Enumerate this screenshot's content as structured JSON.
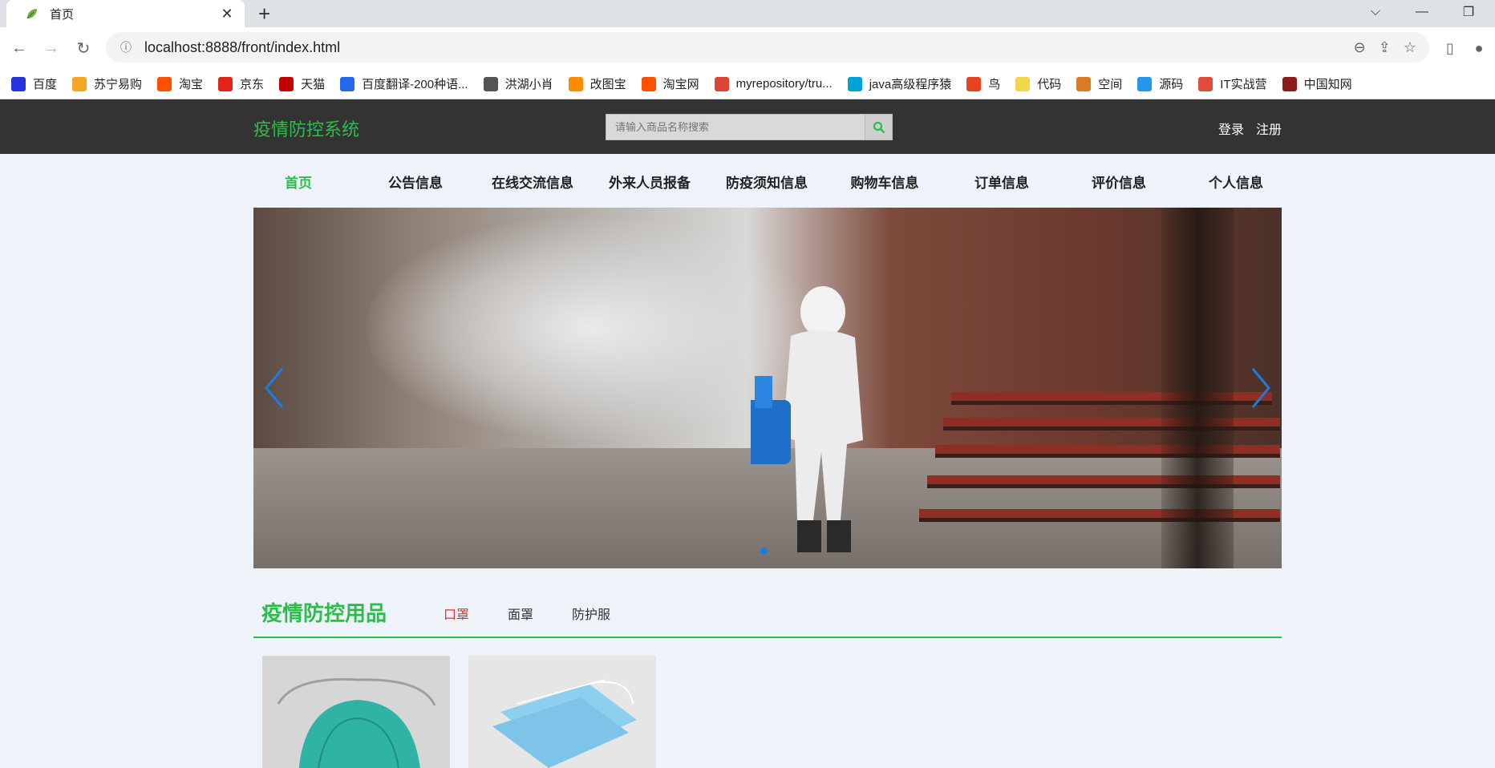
{
  "browser": {
    "tab": {
      "title": "首页"
    },
    "url": "localhost:8888/front/index.html",
    "bookmarks": [
      {
        "label": "百度",
        "icon": "baidu-icon",
        "color": "#2932e1"
      },
      {
        "label": "苏宁易购",
        "icon": "suning-icon",
        "color": "#f5a623"
      },
      {
        "label": "淘宝",
        "icon": "taobao-icon",
        "color": "#ff5000"
      },
      {
        "label": "京东",
        "icon": "jd-icon",
        "color": "#e1251b"
      },
      {
        "label": "天猫",
        "icon": "tmall-icon",
        "color": "#c40000"
      },
      {
        "label": "百度翻译-200种语...",
        "icon": "translate-icon",
        "color": "#2468f2"
      },
      {
        "label": "洪湖小肖",
        "icon": "bird-icon",
        "color": "#555555"
      },
      {
        "label": "改图宝",
        "icon": "image-tool-icon",
        "color": "#ff8c00"
      },
      {
        "label": "淘宝网",
        "icon": "taobao-icon",
        "color": "#ff5000"
      },
      {
        "label": "myrepository/tru...",
        "icon": "chrome-icon",
        "color": "#db4437"
      },
      {
        "label": "java高级程序猿",
        "icon": "bilibili-icon",
        "color": "#00a1d6"
      },
      {
        "label": "鸟",
        "icon": "bird-icon",
        "color": "#e8431f"
      },
      {
        "label": "代码",
        "icon": "code-icon",
        "color": "#f2d64b"
      },
      {
        "label": "空间",
        "icon": "space-icon",
        "color": "#d97b22"
      },
      {
        "label": "源码",
        "icon": "docker-icon",
        "color": "#2496ed"
      },
      {
        "label": "IT实战营",
        "icon": "camp-icon",
        "color": "#e04b3a"
      },
      {
        "label": "中国知网",
        "icon": "cnki-icon",
        "color": "#8b1a1a"
      }
    ]
  },
  "site": {
    "logo": "疫情防控系统",
    "search_placeholder": "请输入商品名称搜索",
    "login": "登录",
    "register": "注册",
    "nav": [
      "首页",
      "公告信息",
      "在线交流信息",
      "外来人员报备",
      "防疫须知信息",
      "购物车信息",
      "订单信息",
      "评价信息",
      "个人信息"
    ],
    "section": {
      "title": "疫情防控用品",
      "categories": [
        "口罩",
        "面罩",
        "防护服"
      ]
    },
    "colors": {
      "brand_green": "#2ebd4b",
      "header_bg": "#333333",
      "active_red": "#e03131",
      "arrow_blue": "#1f7ae0"
    }
  }
}
